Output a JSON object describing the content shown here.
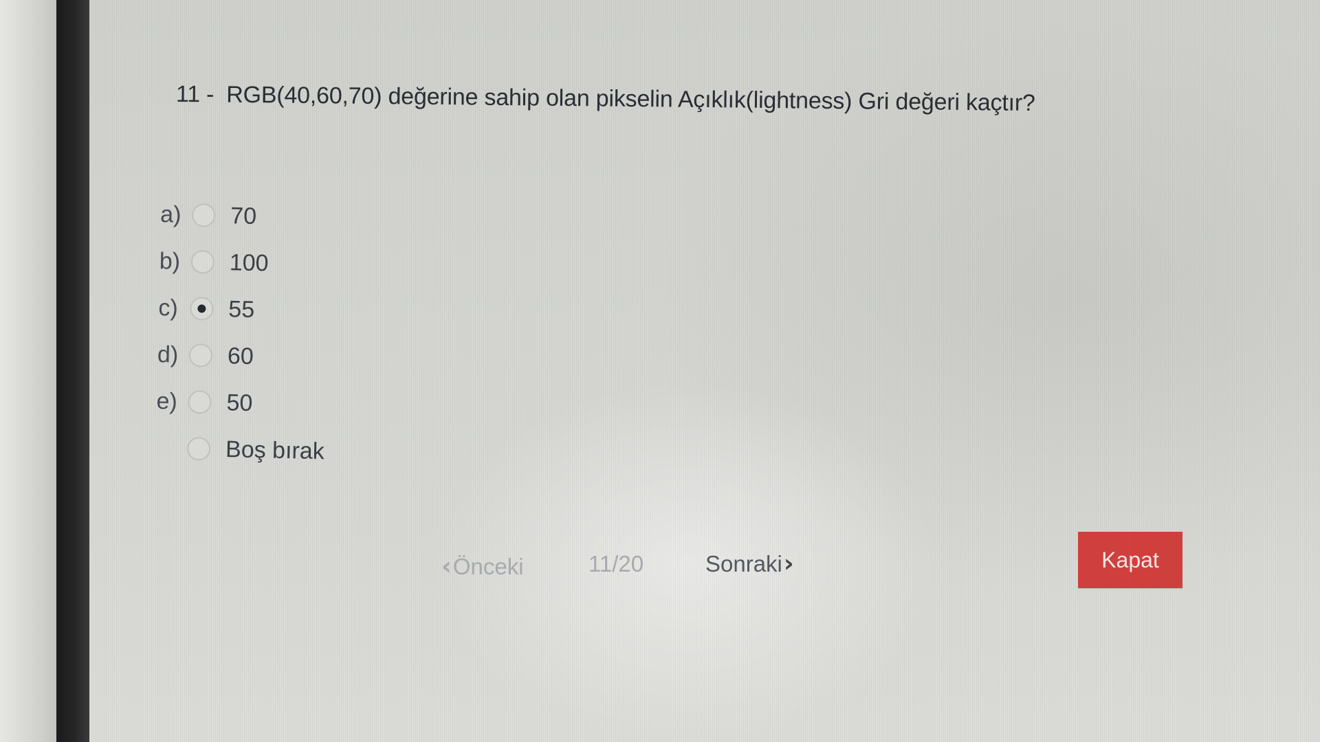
{
  "question": {
    "number": "11 -",
    "text": "RGB(40,60,70) değerine sahip olan pikselin Açıklık(lightness) Gri değeri kaçtır?"
  },
  "options": [
    {
      "letter": "a)",
      "text": "70",
      "selected": false
    },
    {
      "letter": "b)",
      "text": "100",
      "selected": false
    },
    {
      "letter": "c)",
      "text": "55",
      "selected": true
    },
    {
      "letter": "d)",
      "text": "60",
      "selected": false
    },
    {
      "letter": "e)",
      "text": "50",
      "selected": false
    },
    {
      "letter": "",
      "text": "Boş bırak",
      "selected": false
    }
  ],
  "navigation": {
    "prev_label": "Önceki",
    "page_indicator": "11/20",
    "next_label": "Sonraki"
  },
  "close_button": {
    "label": "Kapat",
    "color": "#d2403e"
  }
}
